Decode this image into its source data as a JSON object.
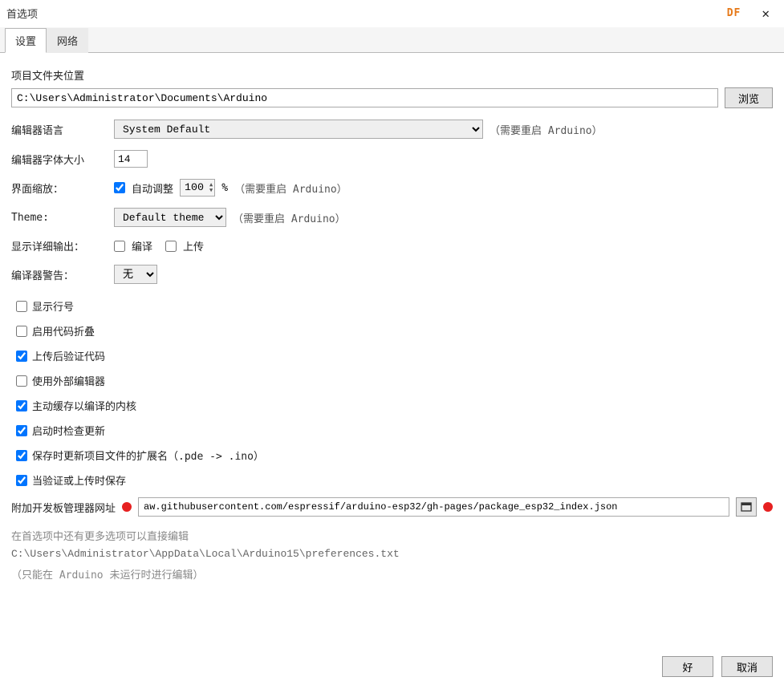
{
  "window": {
    "title": "首选项",
    "brand": "DF"
  },
  "tabs": {
    "settings": "设置",
    "network": "网络"
  },
  "labels": {
    "folder_location": "项目文件夹位置",
    "browse": "浏览",
    "editor_lang": "编辑器语言",
    "restart_note": "（需要重启 Arduino）",
    "font_size": "编辑器字体大小",
    "ui_scale": "界面缩放：",
    "auto_adjust": "自动调整",
    "percent": "%",
    "theme": "Theme:",
    "verbose_output": "显示详细输出：",
    "compile": "编译",
    "upload": "上传",
    "compiler_warnings": "编译器警告：",
    "board_urls": "附加开发板管理器网址",
    "more_prefs_note": "在首选项中还有更多选项可以直接编辑",
    "only_when_not_running": "（只能在 Arduino 未运行时进行编辑）"
  },
  "values": {
    "folder_path": "C:\\Users\\Administrator\\Documents\\Arduino",
    "editor_lang": "System Default",
    "font_size": "14",
    "scale_value": "100",
    "theme": "Default theme",
    "warnings": "无",
    "board_url": "aw.githubusercontent.com/espressif/arduino-esp32/gh-pages/package_esp32_index.json",
    "prefs_path": "C:\\Users\\Administrator\\AppData\\Local\\Arduino15\\preferences.txt"
  },
  "checkboxes": {
    "auto_adjust": true,
    "compile": false,
    "upload": false,
    "show_line_numbers": {
      "label": "显示行号",
      "checked": false
    },
    "enable_folding": {
      "label": "启用代码折叠",
      "checked": false
    },
    "verify_after_upload": {
      "label": "上传后验证代码",
      "checked": true
    },
    "use_external_editor": {
      "label": "使用外部编辑器",
      "checked": false
    },
    "cache_kernels": {
      "label": "主动缓存以编译的内核",
      "checked": true
    },
    "check_updates": {
      "label": "启动时检查更新",
      "checked": true
    },
    "update_extension": {
      "label": "保存时更新项目文件的扩展名（.pde -> .ino）",
      "checked": true
    },
    "save_on_verify": {
      "label": "当验证或上传时保存",
      "checked": true
    }
  },
  "buttons": {
    "ok": "好",
    "cancel": "取消"
  }
}
